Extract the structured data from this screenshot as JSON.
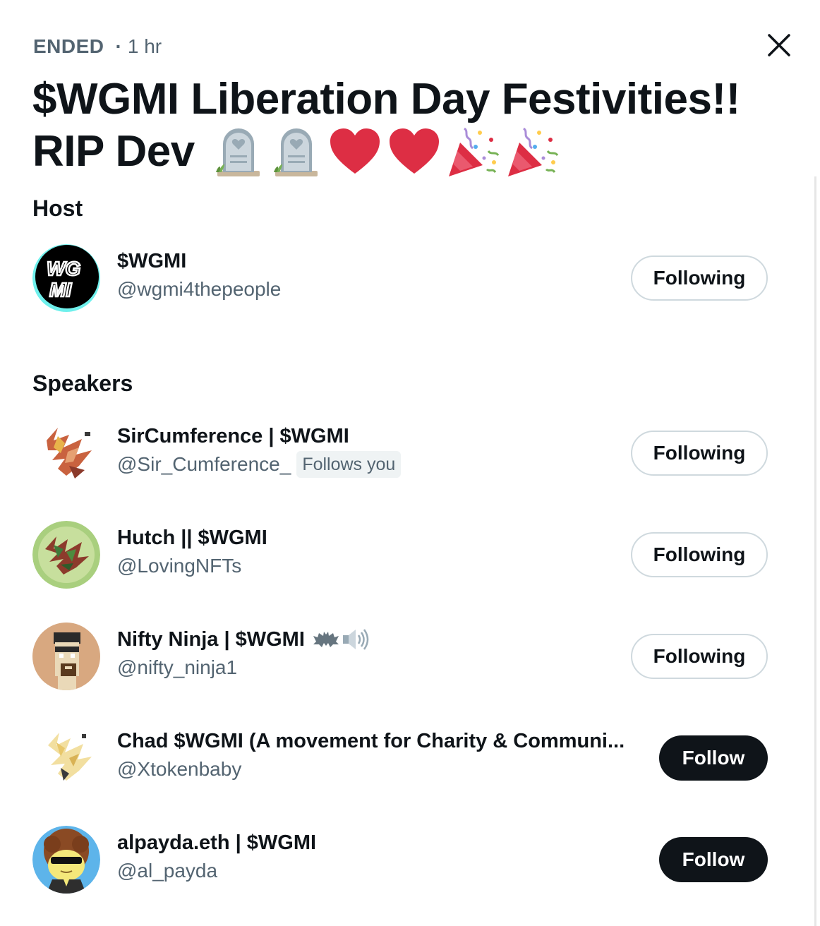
{
  "header": {
    "status": "ENDED",
    "separator": "·",
    "duration": "1 hr",
    "title_line1": "$WGMI Liberation Day Festivities!!",
    "title_line2": "RIP Dev",
    "title_emojis": [
      "headstone",
      "headstone",
      "red-heart",
      "red-heart",
      "party-popper",
      "party-popper"
    ],
    "close_icon": "close-icon"
  },
  "host_section": {
    "heading": "Host",
    "users": [
      {
        "name": "$WGMI",
        "handle": "@wgmi4thepeople",
        "button": "Following",
        "avatar_text": "WG MI"
      }
    ]
  },
  "speakers_section": {
    "heading": "Speakers",
    "users": [
      {
        "name": "SirCumference | $WGMI",
        "handle": "@Sir_Cumference_",
        "badge": "Follows you",
        "button": "Following"
      },
      {
        "name": "Hutch || $WGMI",
        "handle": "@LovingNFTs",
        "button": "Following"
      },
      {
        "name": "Nifty Ninja | $WGMI",
        "handle": "@nifty_ninja1",
        "name_emojis": [
          "bat",
          "speaker-high-volume"
        ],
        "button": "Following"
      },
      {
        "name": "Chad $WGMI (A movement for Charity & Communi...",
        "handle": "@Xtokenbaby",
        "button": "Follow"
      },
      {
        "name": "alpayda.eth | $WGMI",
        "handle": "@al_payda",
        "button": "Follow"
      }
    ]
  },
  "colors": {
    "text_primary": "#0f1419",
    "text_secondary": "#536471",
    "button_border": "#cfd9de",
    "follow_button_bg": "#0f1419",
    "badge_bg": "#eff3f4",
    "heart": "#dd2e44"
  }
}
